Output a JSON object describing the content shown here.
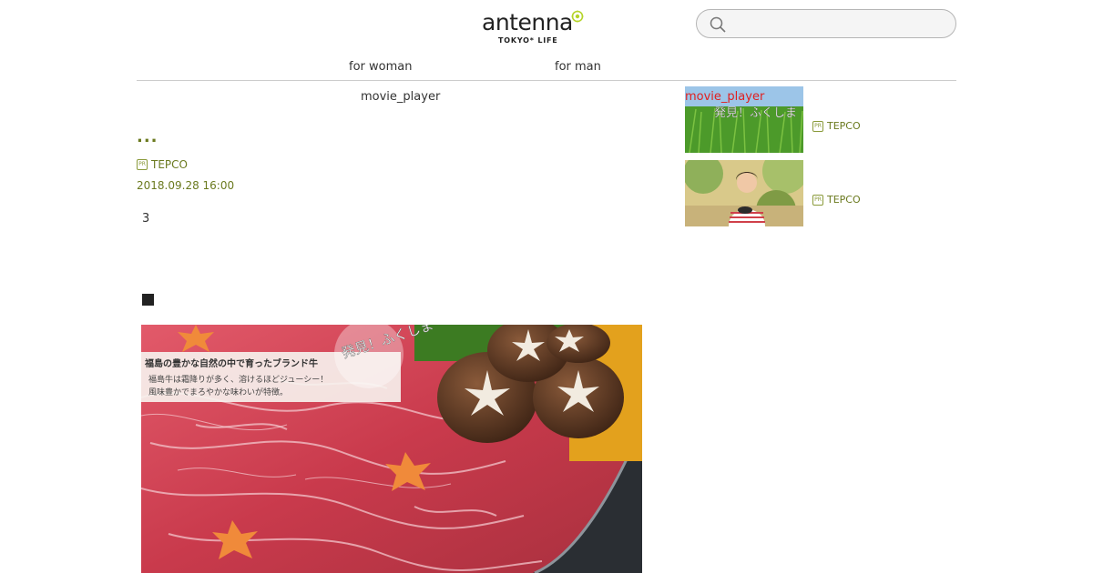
{
  "header": {
    "logo_text": "antenna",
    "logo_sub": "TOKYO* LIFE",
    "search": {
      "placeholder": "",
      "value": ""
    }
  },
  "nav": {
    "items": [
      {
        "label": "for woman"
      },
      {
        "label": "for man"
      }
    ]
  },
  "article": {
    "player_label": "movie_player",
    "title": "...",
    "pr_badge": "PR",
    "sponsor": "TEPCO",
    "date": "2018.09.28 16:00",
    "count": "3",
    "section_marker": "■",
    "image_caption": {
      "title": "福島の豊かな自然の中で育ったブランド牛",
      "line1": "福島牛は霜降りが多く、溶けるほどジューシー！",
      "line2": "風味豊かでまろやかな味わいが特徴。",
      "stamp": "発見！ふくしま"
    }
  },
  "sidebar": {
    "items": [
      {
        "overlay": "movie_player",
        "thumb_text": "発見！ふくしま",
        "pr_badge": "PR",
        "sponsor": "TEPCO"
      },
      {
        "overlay": "",
        "thumb_text": "",
        "pr_badge": "PR",
        "sponsor": "TEPCO"
      }
    ]
  },
  "colors": {
    "accent": "#6b7a1f",
    "logo_flower": "#b5d42a",
    "overlay_red": "#e02020"
  }
}
